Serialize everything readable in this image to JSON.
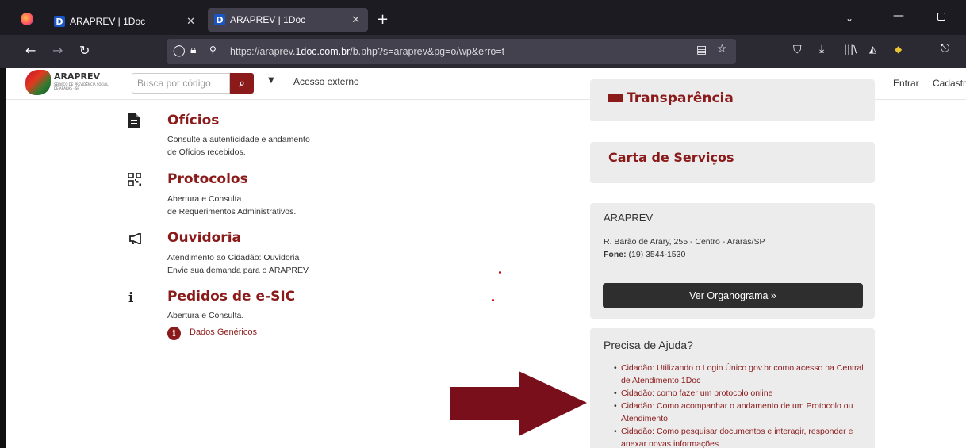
{
  "browser": {
    "tabs": [
      {
        "title": "ARAPREV | 1Doc",
        "active": false
      },
      {
        "title": "ARAPREV | 1Doc",
        "active": true
      }
    ],
    "new_tab_icon": "plus-icon",
    "url": {
      "prefix": "https://araprev.",
      "host": "1doc.com.br",
      "path": "/b.php?s=araprev&pg=o/wp&erro=t"
    }
  },
  "site": {
    "logo_text": "ARAPREV",
    "logo_sub": "SERVIÇO DE PREVIDÊNCIA SOCIAL DE ARARAS - SP",
    "search_placeholder": "Busca por código",
    "acesso_externo": "Acesso externo",
    "entrar": "Entrar",
    "cadastro": "Cadastro"
  },
  "services": [
    {
      "icon": "document-icon",
      "glyph": "🗎",
      "title": "Ofícios",
      "desc": [
        "Consulte a autenticidade e andamento",
        "de Ofícios recebidos."
      ]
    },
    {
      "icon": "qrcode-icon",
      "glyph": "▦",
      "title": "Protocolos",
      "desc": [
        "Abertura e Consulta",
        "de Requerimentos Administrativos."
      ]
    },
    {
      "icon": "megaphone-icon",
      "glyph": "📢",
      "title": "Ouvidoria",
      "desc": [
        "Atendimento ao Cidadão: Ouvidoria",
        "Envie sua demanda para o ARAPREV"
      ]
    },
    {
      "icon": "info-icon",
      "glyph": "i",
      "title": "Pedidos de e-SIC",
      "desc": [
        "Abertura e Consulta."
      ]
    }
  ],
  "dados_genericos": "Dados Genéricos",
  "right": {
    "transparencia": "Transparência",
    "carta": "Carta de Serviços",
    "org_name": "ARAPREV",
    "address": "R. Barão de Arary, 255 - Centro - Araras/SP",
    "fone_label": "Fone:",
    "fone_value": " (19) 3544-1530",
    "organograma_button": "Ver Organograma »",
    "help_title": "Precisa de Ajuda?",
    "help_items": [
      "Cidadão: Utilizando o Login Único gov.br como acesso na Central de Atendimento 1Doc",
      "Cidadão: como fazer um protocolo online",
      "Cidadão: Como acompanhar o andamento de um Protocolo ou Atendimento",
      "Cidadão: Como pesquisar documentos e interagir, responder e anexar novas informações"
    ]
  },
  "colors": {
    "brand": "#8b1a1a",
    "arrow": "#7a0f1c"
  }
}
